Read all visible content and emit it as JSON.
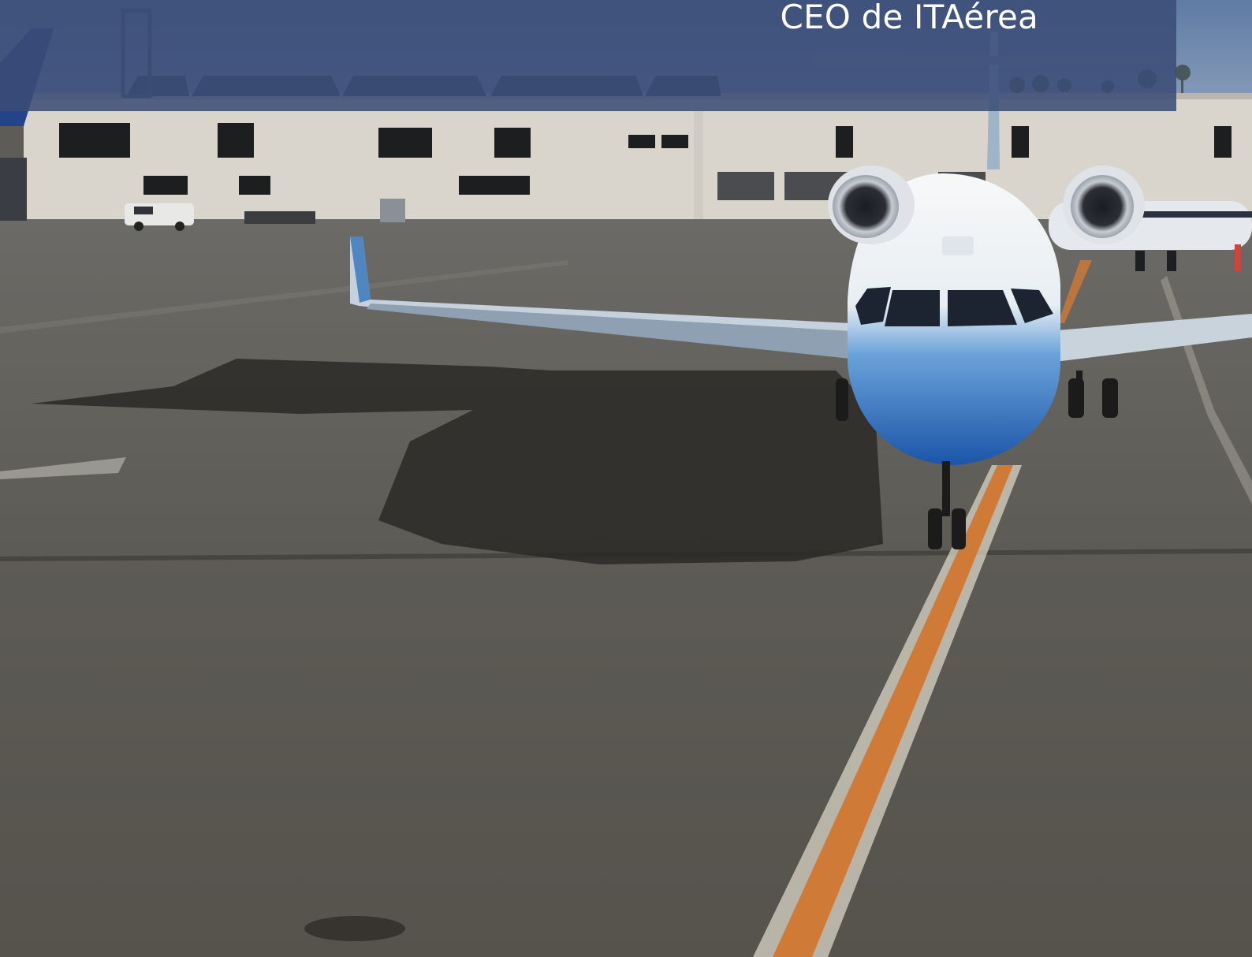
{
  "caption": {
    "text": "CEO de ITAérea"
  },
  "photo": {
    "subject": "regional-jet-taxiing-on-apron",
    "colors": {
      "sky": "#6b84a8",
      "terminal": "#d8d4cb",
      "tarmac": "#615f59",
      "fuselage_white": "#f3f4f4",
      "fuselage_blue": "#1f5fb5",
      "taxi_line": "#d07a35",
      "caption_band": "#3a4c76"
    }
  }
}
